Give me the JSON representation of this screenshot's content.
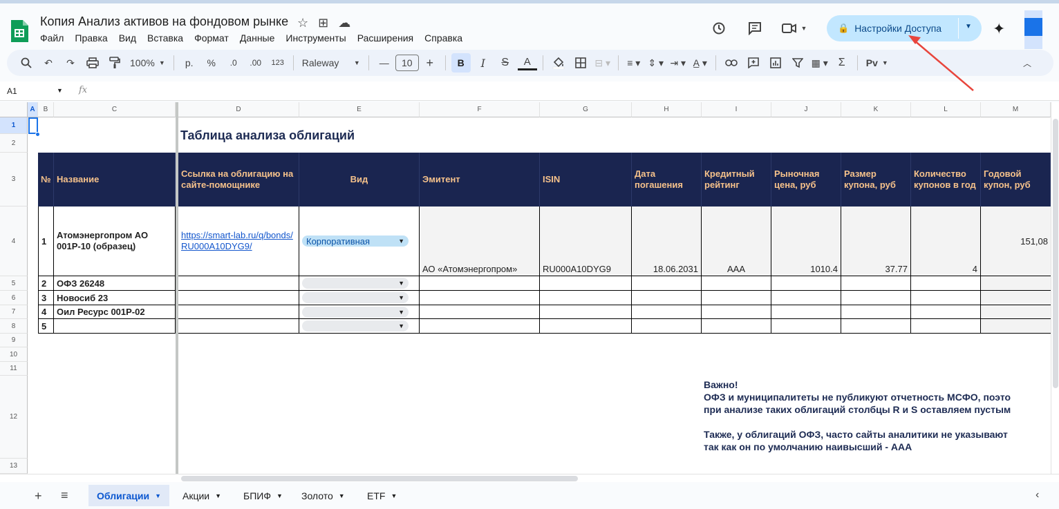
{
  "app": {
    "title": "Копия Анализ активов на фондовом рынке",
    "menu": [
      "Файл",
      "Правка",
      "Вид",
      "Вставка",
      "Формат",
      "Данные",
      "Инструменты",
      "Расширения",
      "Справка"
    ],
    "share_label": "Настройки Доступа",
    "accent_color": "#c2e7ff"
  },
  "toolbar": {
    "zoom": "100%",
    "currency": "р.",
    "percent": "%",
    "dec_down": ".0",
    "dec_up": ".00",
    "format_more": "123",
    "font": "Raleway",
    "font_size": "10",
    "bold": "B",
    "italic": "I",
    "text_color": "A",
    "sum": "Σ",
    "script": "Pv"
  },
  "formula_bar": {
    "name_box": "A1",
    "fx": "fx"
  },
  "columns": [
    "A",
    "B",
    "C",
    "D",
    "E",
    "F",
    "G",
    "H",
    "I",
    "J",
    "K",
    "L",
    "M"
  ],
  "rows": [
    "1",
    "2",
    "3",
    "4",
    "5",
    "6",
    "7",
    "8",
    "9",
    "10",
    "11",
    "12",
    "13"
  ],
  "sheet": {
    "title": "Таблица анализа облигаций",
    "headers": {
      "b": "№",
      "c": "Название",
      "d": "Ссылка на облигацию на сайте-помощнике",
      "e": "Вид",
      "f": "Эмитент",
      "g": "ISIN",
      "h": "Дата погашения",
      "i": "Кредитный рейтинг",
      "j": "Рыночная цена, руб",
      "k": "Размер купона, руб",
      "l": "Количество купонов в год",
      "m": "Годовой купон, руб"
    },
    "rows": [
      {
        "num": "1",
        "name": "Атомэнергопром АО 001P-10 (образец)",
        "link": "https://smart-lab.ru/q/bonds/RU000A10DYG9/",
        "type": "Корпоративная",
        "issuer": "АО «Атомэнергопром»",
        "isin": "RU000A10DYG9",
        "maturity": "18.06.2031",
        "rating": "AAA",
        "price": "1010.4",
        "coupon": "37.77",
        "coupons_per_year": "4",
        "annual_coupon": "151,08"
      },
      {
        "num": "2",
        "name": "ОФЗ 26248"
      },
      {
        "num": "3",
        "name": "Новосиб 23"
      },
      {
        "num": "4",
        "name": "Оил Ресурс 001Р-02"
      },
      {
        "num": "5",
        "name": ""
      }
    ],
    "note": {
      "l1": "Важно!",
      "l2": "ОФЗ и муниципалитеты не публикуют отчетность МСФО, поэто",
      "l3": "при анализе таких облигаций столбцы R и S оставляем пустым",
      "l4": "Также, у облигаций ОФЗ, часто сайты аналитики не указывают",
      "l5": "так как он по умолчанию наивысший - ААА"
    }
  },
  "tabs": [
    "Облигации",
    "Акции",
    "БПИФ",
    "Золото",
    "ETF"
  ],
  "active_tab": "Облигации"
}
